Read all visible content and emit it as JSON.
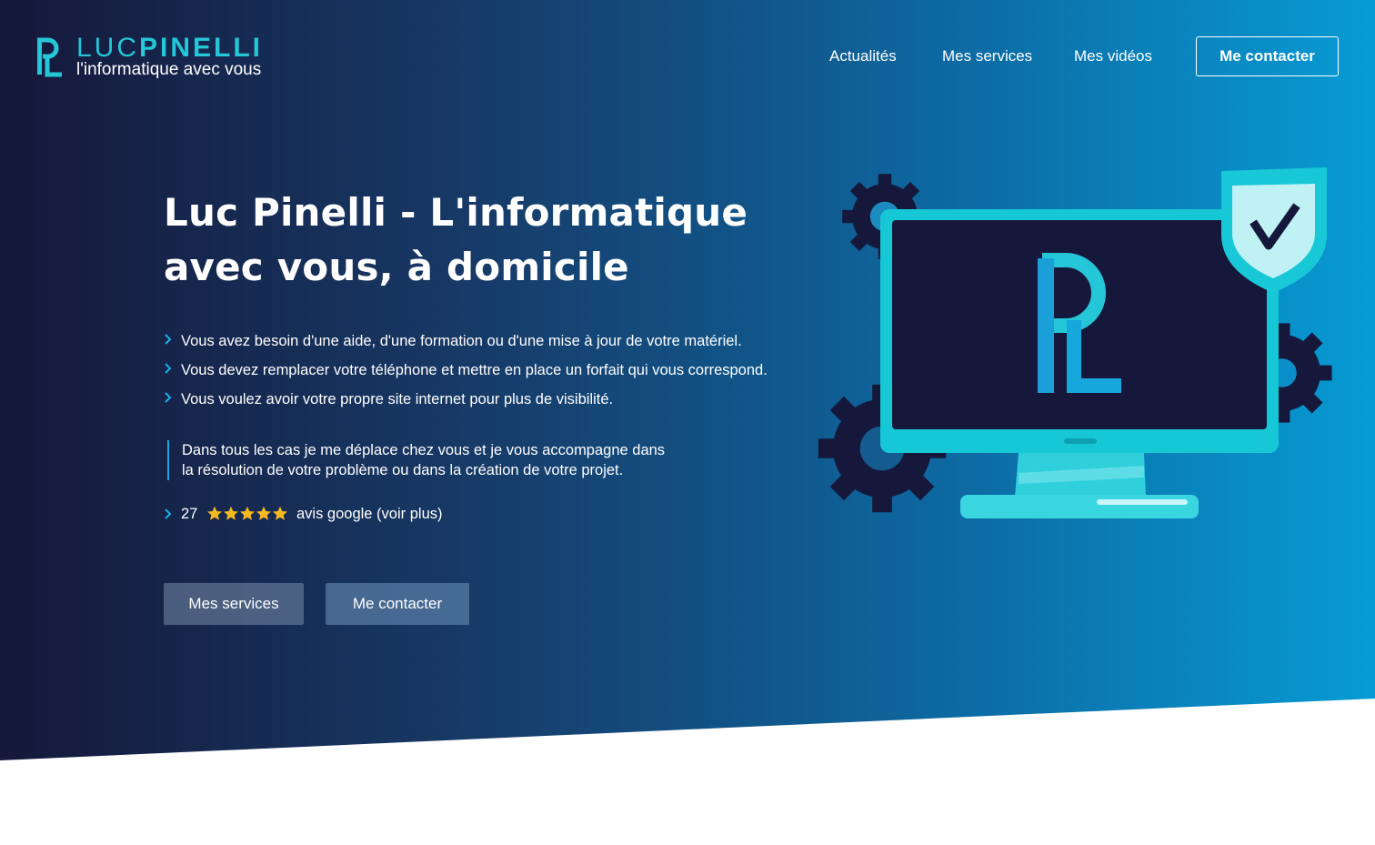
{
  "colors": {
    "accent": "#24c6d8",
    "hero_dark": "#15183a",
    "hero_light": "#079bd4",
    "star": "#f5b921"
  },
  "header": {
    "logo": {
      "name_part1": "LUC",
      "name_part2": "PINELLI",
      "tagline": "l'informatique avec vous"
    },
    "nav": [
      {
        "label": "Actualités"
      },
      {
        "label": "Mes services"
      },
      {
        "label": "Mes vidéos"
      }
    ],
    "cta_label": "Me contacter"
  },
  "hero": {
    "title": "Luc Pinelli - L'informatique avec vous, à domicile",
    "bullets": [
      "Vous avez besoin d'une aide, d'une formation ou d'une mise à jour de votre matériel.",
      "Vous devez remplacer votre téléphone et mettre en place un forfait qui vous correspond.",
      "Vous voulez avoir votre propre site internet pour plus de visibilité."
    ],
    "quote_line1": "Dans tous les cas je me déplace chez vous et je vous accompagne dans",
    "quote_line2": "la résolution de votre problème ou dans la création de votre projet.",
    "rating": {
      "count": "27",
      "stars": 5,
      "text": "avis google (voir plus)"
    },
    "buttons": {
      "services": "Mes services",
      "contact": "Me contacter"
    },
    "illustration_icons": [
      "gear-icon",
      "monitor-icon",
      "shield-check-icon"
    ]
  }
}
